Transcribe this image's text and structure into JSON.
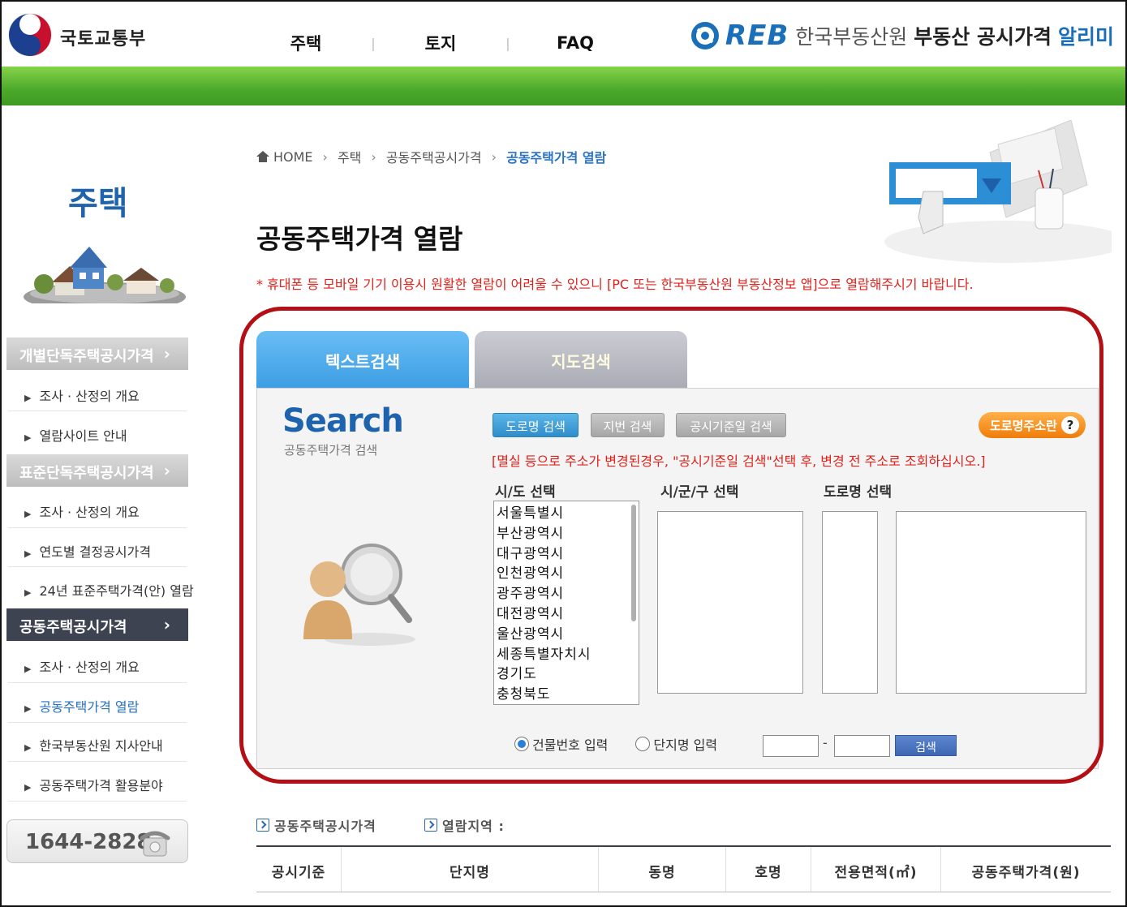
{
  "header": {
    "org_name": "국토교통부",
    "nav": [
      "주택",
      "토지",
      "FAQ"
    ],
    "nav_separator": "|",
    "brand_logo": "REB",
    "brand_org": "한국부동산원",
    "brand_title": "부동산 공시가격",
    "brand_title_accent": "알리미"
  },
  "sidebar": {
    "title": "주택",
    "categories": [
      {
        "label": "개별단독주택공시가격",
        "sub": [
          "조사 · 산정의 개요",
          "열람사이트 안내"
        ]
      },
      {
        "label": "표준단독주택공시가격",
        "sub": [
          "조사 · 산정의 개요",
          "연도별 결정공시가격",
          "24년 표준주택가격(안) 열람"
        ]
      },
      {
        "label": "공동주택공시가격",
        "sub": [
          "조사 · 산정의 개요",
          "공동주택가격 열람",
          "한국부동산원 지사안내",
          "공동주택가격 활용분야"
        ]
      }
    ],
    "chevron": "›",
    "phone": "1644-2828"
  },
  "breadcrumb": [
    "HOME",
    "주택",
    "공동주택공시가격",
    "공동주택가격 열람"
  ],
  "page_title": "공동주택가격 열람",
  "notice": "* 휴대폰 등 모바일 기기 이용시 원활한 열람이 어려울 수 있으니 [PC 또는 한국부동산원 부동산정보 앱]으로 열람해주시기 바랍니다.",
  "tabs": {
    "text_search": "텍스트검색",
    "map_search": "지도검색"
  },
  "search": {
    "title": "Search",
    "subtitle": "공동주택가격 검색",
    "btn_road": "도로명 검색",
    "btn_lot": "지번 검색",
    "btn_date": "공시기준일 검색",
    "btn_road_info": "도로명주소란",
    "help_mark": "?",
    "hint": "[멸실 등으로 주소가 변경된경우, \"공시기준일 검색\"선택 후, 변경 전 주소로 조회하십시오.]",
    "col_sido": "시/도 선택",
    "col_sigungu": "시/군/구 선택",
    "col_road": "도로명 선택",
    "sido_options": [
      "서울특별시",
      "부산광역시",
      "대구광역시",
      "인천광역시",
      "광주광역시",
      "대전광역시",
      "울산광역시",
      "세종특별자치시",
      "경기도",
      "충청북도"
    ],
    "radio_building": "건물번호 입력",
    "radio_complex": "단지명 입력",
    "radio_selected": "건물번호 입력",
    "dash": "-",
    "btn_search": "검색"
  },
  "results": {
    "label_price": "공동주택공시가격",
    "label_region": "열람지역 :",
    "columns": [
      "공시기준",
      "단지명",
      "동명",
      "호명",
      "전용면적(㎡)",
      "공동주택가격(원)"
    ]
  },
  "colors": {
    "brand_blue": "#1e63ac",
    "green_bar": "#4aa92a",
    "notice_red": "#e0201a",
    "highlight_outline": "#b30f14",
    "tab_active": "#3c9de3",
    "tab_inactive": "#a9abb4",
    "orange_button": "#ef7d0a"
  },
  "icons": [
    "government-emblem-icon",
    "reb-logo-icon",
    "home-icon",
    "chevron-right-icon",
    "phone-icon",
    "question-icon",
    "box-arrow-icon"
  ]
}
